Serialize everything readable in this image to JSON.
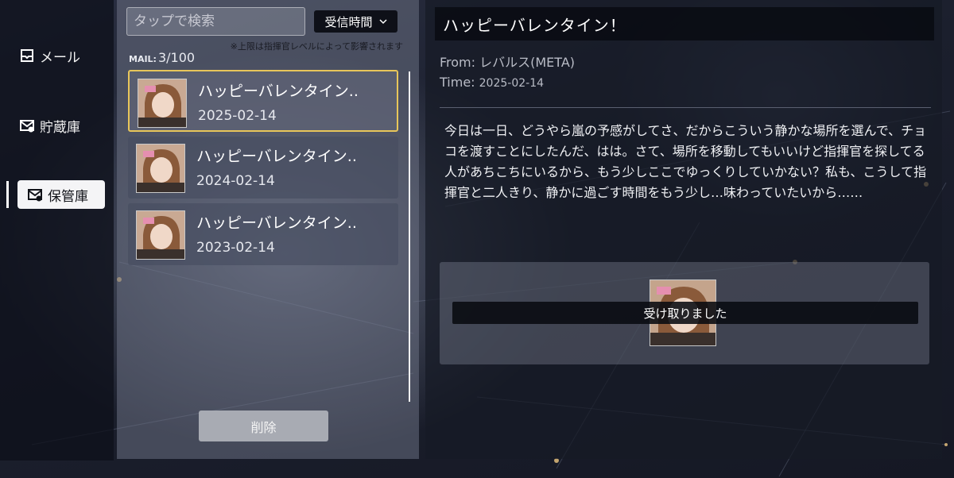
{
  "nav": {
    "items": [
      {
        "label": "メール",
        "icon": "mail-inbox-icon",
        "active": false
      },
      {
        "label": "貯蔵庫",
        "icon": "mail-storage-icon",
        "active": false
      },
      {
        "label": "保管庫",
        "icon": "mail-archive-icon",
        "active": true
      }
    ]
  },
  "list": {
    "search_placeholder": "タップで検索",
    "sort_label": "受信時間",
    "note": "※上限は指揮官レベルによって影響されます",
    "mail_label": "MAIL:",
    "mail_count": "3",
    "mail_max": "100",
    "items": [
      {
        "title": "ハッピーバレンタイン..",
        "date": "2025-02-14",
        "selected": true
      },
      {
        "title": "ハッピーバレンタイン..",
        "date": "2024-02-14",
        "selected": false
      },
      {
        "title": "ハッピーバレンタイン..",
        "date": "2023-02-14",
        "selected": false
      }
    ],
    "delete_label": "削除"
  },
  "detail": {
    "title": "ハッピーバレンタイン！",
    "from_label": "From:",
    "from_value": "レバルス(META)",
    "time_label": "Time:",
    "time_value": "2025-02-14",
    "body": "今日は一日、どうやら嵐の予感がしてさ、だからこういう静かな場所を選んで、チョコを渡すことにしたんだ、はは。さて、場所を移動してもいいけど指揮官を探してる人があちこちにいるから、もう少しここでゆっくりしていかない？私も、こうして指揮官と二人きり、静かに過ごす時間をもう少し…味わっていたいから……",
    "reward_status": "受け取りました"
  },
  "colors": {
    "selected_border": "#e8c65a",
    "panel_dark": "#0e1018"
  }
}
